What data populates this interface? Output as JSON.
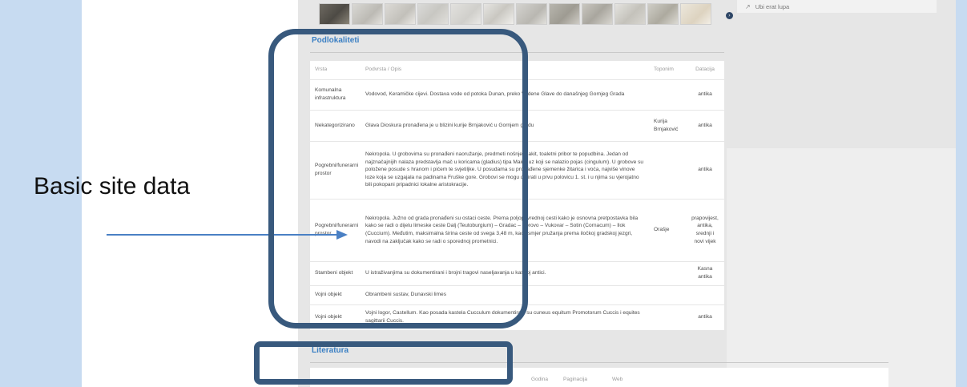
{
  "annotation": {
    "label": "Basic site data",
    "frame_color": "#38597d",
    "arrow_color": "#4a80c4"
  },
  "gallery": {
    "thumb_count": 12,
    "next_icon": "chevron-right-circle-icon"
  },
  "sidebar_box": {
    "icon": "external-link-icon",
    "text": "Ubi erat lupa"
  },
  "podlokaliteti": {
    "title": "Podlokaliteti",
    "columns": [
      "Vrsta",
      "Podvrsta / Opis",
      "Toponim",
      "Datacija"
    ],
    "rows": [
      {
        "vrsta": "Komunalna infrastruktura",
        "opis": "Vodovod, Keramičke cijevi. Dostava vode od potoka Dunan, preko Vodene Glave do današnjeg Gornjeg Grada",
        "toponim": "",
        "datacija": "antika"
      },
      {
        "vrsta": "Nekategorizirano",
        "opis": "Glava Dioskura pronađena je u blizini kurije Brnjaković u Gornjem gradu",
        "toponim": "Kurija Brnjaković",
        "datacija": "antika"
      },
      {
        "vrsta": "Pogrebni/funerarni prostor",
        "opis": "Nekropola. U grobovima su pronađeni naoružanje, predmeti nošnje, nakit, toaletni pribor te popudbina. Jedan od najznačajnijih nalaza predstavlja mač u koricama (gladius) tipa Mainz uz koji se nalazio pojas (cingulum). U grobove su položene posude s hranom i pićem te svjetiljke. U posudama su pronađene sjemenke žitarica i voća, najviše vinove loze koja se uzgajala na padinama Fruške gore. Grobovi se mogu datirati u prvu polovicu 1. st. i u njima su vjerojatno bili pokopani pripadnici lokalne aristokracije.",
        "toponim": "",
        "datacija": "antika"
      },
      {
        "vrsta": "Pogrebni/funerarni prostor",
        "opis": "Nekropola. Južno od grada pronađeni su ostaci ceste. Prema poljoprivrednoj cesti kako je osnovna pretpostavka bila kako se radi o dijelu limeske ceste Dalj (Teutoburgium) – Gradac – Borovo – Vukovar – Sotin (Cornacum) – Ilok (Cuccium). Međutim, maksimalna širina ceste od svega 3,48 m, kao i smjer pružanja prema iločkoj gradskoj jezgri, navodi na zaključak kako se radi o sporednoj prometnici.",
        "toponim": "Orašje",
        "datacija": "prapovijest, antika, srednji i novi vijek"
      },
      {
        "vrsta": "Stambeni objekt",
        "opis": "U istraživanjima su dokumentirani i brojni tragovi naseljavanja u kasnoj antici.",
        "toponim": "",
        "datacija": "Kasna antika"
      },
      {
        "vrsta": "Vojni objekt",
        "opis": "Obrambeni sustav, Dunavski limes",
        "toponim": "",
        "datacija": ""
      },
      {
        "vrsta": "Vojni objekt",
        "opis": "Vojni logor, Castellum. Kao posada kastela Cucculum dokumentirani su cuneus equitum Promotorum Cuccis i equites sagittarii Cuccis.",
        "toponim": "",
        "datacija": "antika"
      }
    ]
  },
  "literatura": {
    "title": "Literatura",
    "columns": [
      "Godina",
      "Paginacija",
      "Web"
    ]
  }
}
